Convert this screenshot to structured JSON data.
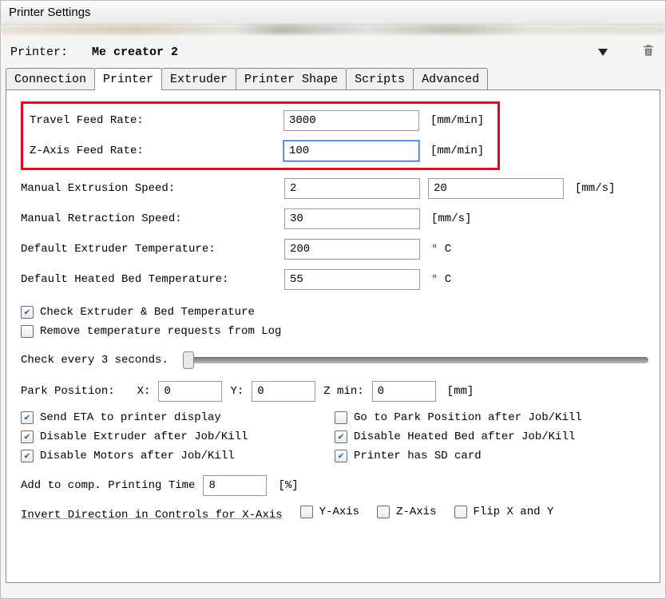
{
  "window": {
    "title": "Printer Settings"
  },
  "topbar": {
    "printer_label": "Printer:",
    "selected_printer": "Me creator 2"
  },
  "tabs": [
    "Connection",
    "Printer",
    "Extruder",
    "Printer Shape",
    "Scripts",
    "Advanced"
  ],
  "active_tab": 1,
  "fields": {
    "travel_feed_rate": {
      "label": "Travel Feed Rate:",
      "value": "3000",
      "unit": "[mm/min]"
    },
    "z_axis_feed_rate": {
      "label": "Z-Axis Feed Rate:",
      "value": "100",
      "unit": "[mm/min]"
    },
    "manual_extrusion": {
      "label": "Manual Extrusion Speed:",
      "value1": "2",
      "value2": "20",
      "unit": "[mm/s]"
    },
    "manual_retraction": {
      "label": "Manual Retraction Speed:",
      "value": "30",
      "unit": "[mm/s]"
    },
    "default_extruder_t": {
      "label": "Default Extruder Temperature:",
      "value": "200",
      "unit": "° C"
    },
    "default_bed_t": {
      "label": "Default Heated Bed Temperature:",
      "value": "55",
      "unit": "° C"
    }
  },
  "checkboxes": {
    "check_temp": {
      "label": "Check Extruder & Bed Temperature",
      "checked": true
    },
    "remove_temp_log": {
      "label": "Remove temperature requests from Log",
      "checked": false
    },
    "send_eta": {
      "label": "Send ETA to printer display",
      "checked": true
    },
    "goto_park": {
      "label": "Go to Park Position after Job/Kill",
      "checked": false
    },
    "disable_extruder": {
      "label": "Disable Extruder after Job/Kill",
      "checked": true
    },
    "disable_bed": {
      "label": "Disable Heated Bed after Job/Kill",
      "checked": true
    },
    "disable_motors": {
      "label": "Disable Motors after Job/Kill",
      "checked": true
    },
    "has_sd": {
      "label": "Printer has SD card",
      "checked": true
    }
  },
  "slider": {
    "label": "Check every 3 seconds."
  },
  "park": {
    "label": "Park Position:",
    "x_label": "X:",
    "x": "0",
    "y_label": "Y:",
    "y": "0",
    "z_label": "Z min:",
    "z": "0",
    "unit": "[mm]"
  },
  "comp_time": {
    "label": "Add to comp. Printing Time",
    "value": "8",
    "unit": "[%]"
  },
  "invert": {
    "label": "Invert Direction in Controls for X-Axis",
    "y": {
      "label": "Y-Axis",
      "checked": false
    },
    "z": {
      "label": "Z-Axis",
      "checked": false
    },
    "flip": {
      "label": "Flip X and Y",
      "checked": false
    }
  }
}
